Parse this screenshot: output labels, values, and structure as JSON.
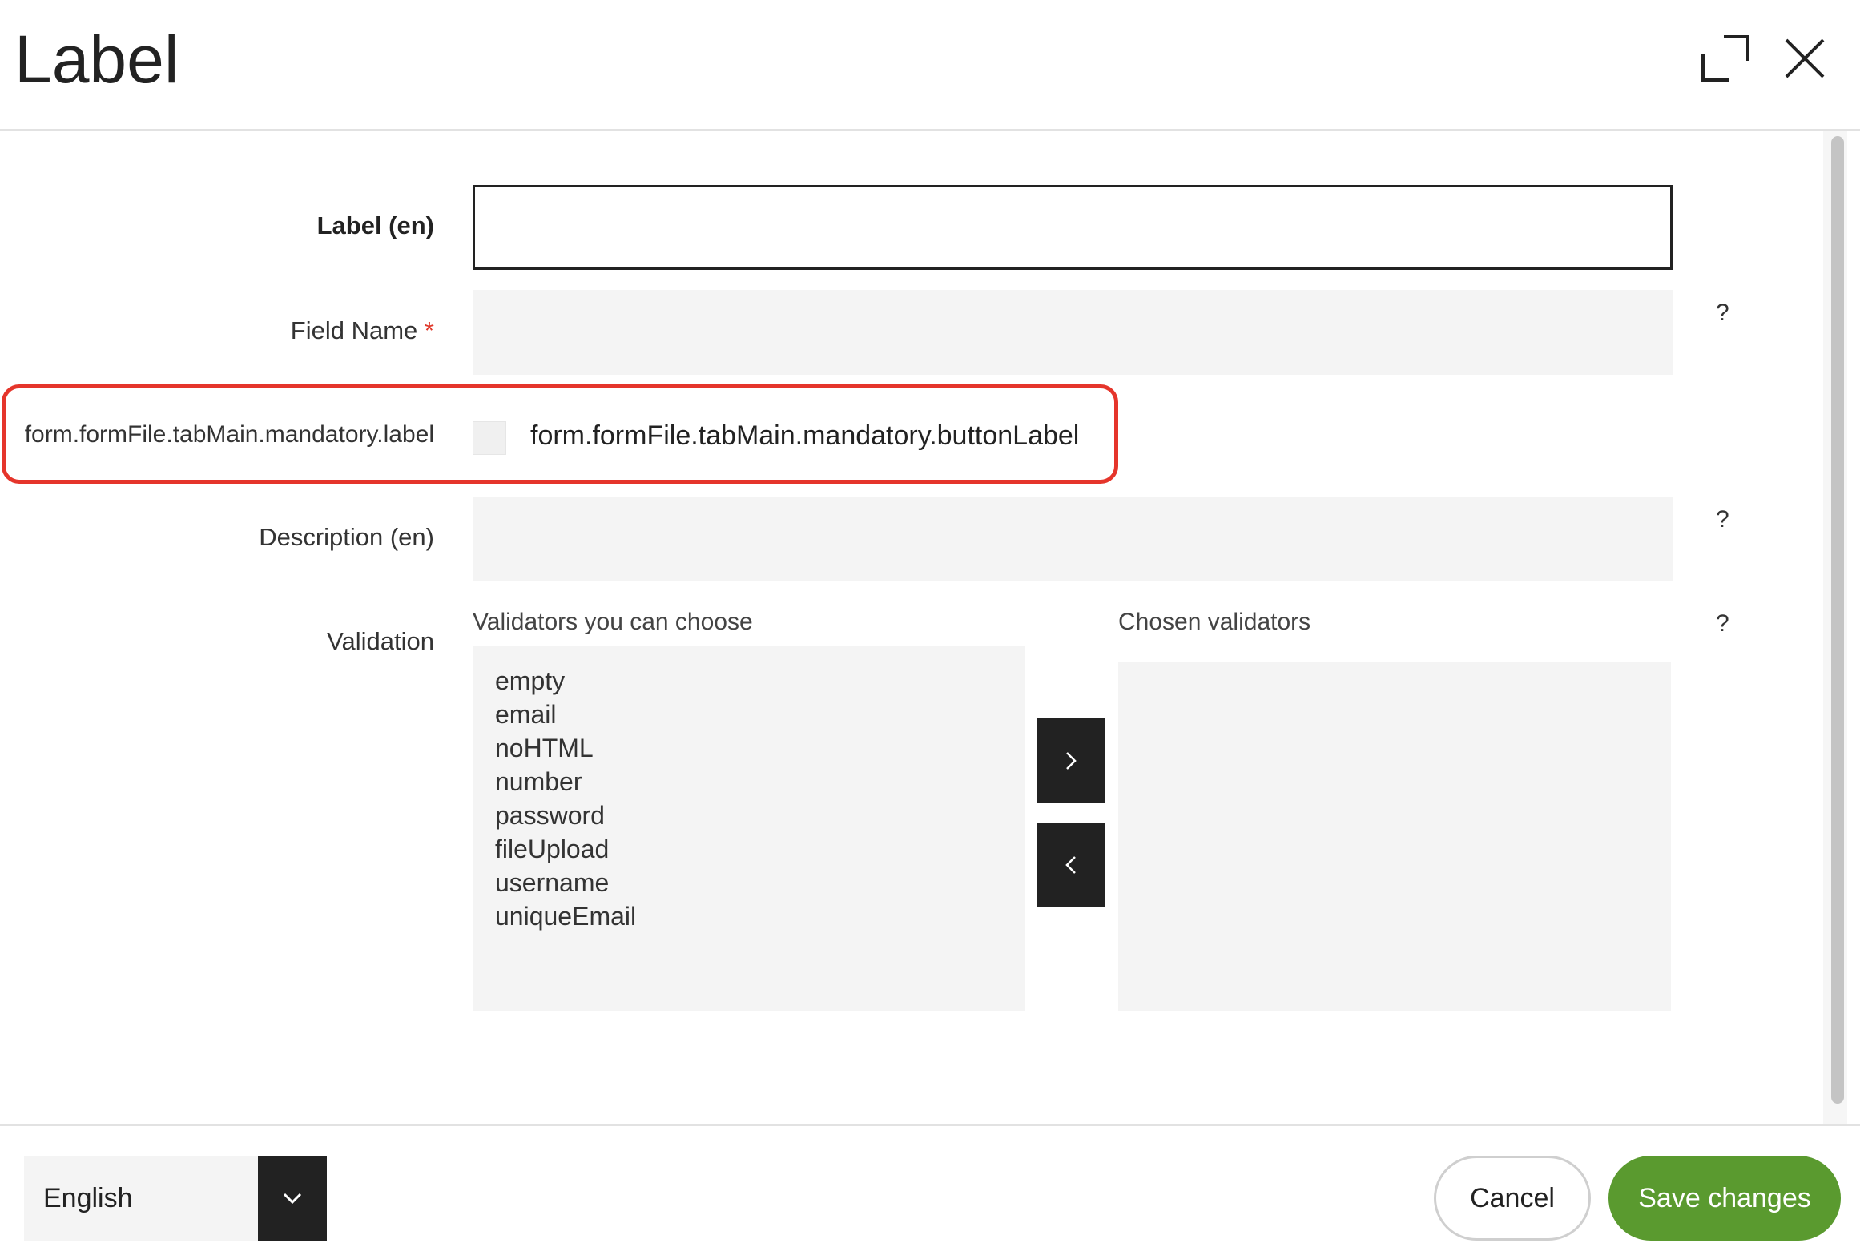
{
  "dialog": {
    "title": "Label",
    "expand_icon": "expand-icon",
    "close_icon": "close-icon"
  },
  "form": {
    "label_field": {
      "label": "Label (en)",
      "value": ""
    },
    "field_name": {
      "label": "Field Name",
      "required_mark": "*",
      "value": "",
      "help": "?"
    },
    "mandatory": {
      "label": "form.formFile.tabMain.mandatory.label",
      "button_label": "form.formFile.tabMain.mandatory.buttonLabel",
      "checked": false
    },
    "description": {
      "label": "Description (en)",
      "value": "",
      "help": "?"
    },
    "validation": {
      "label": "Validation",
      "available_label": "Validators you can choose",
      "chosen_label": "Chosen validators",
      "available": [
        "empty",
        "email",
        "noHTML",
        "number",
        "password",
        "fileUpload",
        "username",
        "uniqueEmail"
      ],
      "chosen": [],
      "add_icon": "chevron-right-icon",
      "remove_icon": "chevron-left-icon",
      "help": "?"
    }
  },
  "footer": {
    "language": "English",
    "language_icon": "chevron-down-icon",
    "cancel_label": "Cancel",
    "save_label": "Save changes"
  },
  "colors": {
    "highlight": "#e5352b",
    "save_button": "#5a9a2f",
    "dark_button": "#222222",
    "field_bg": "#f4f4f4"
  }
}
